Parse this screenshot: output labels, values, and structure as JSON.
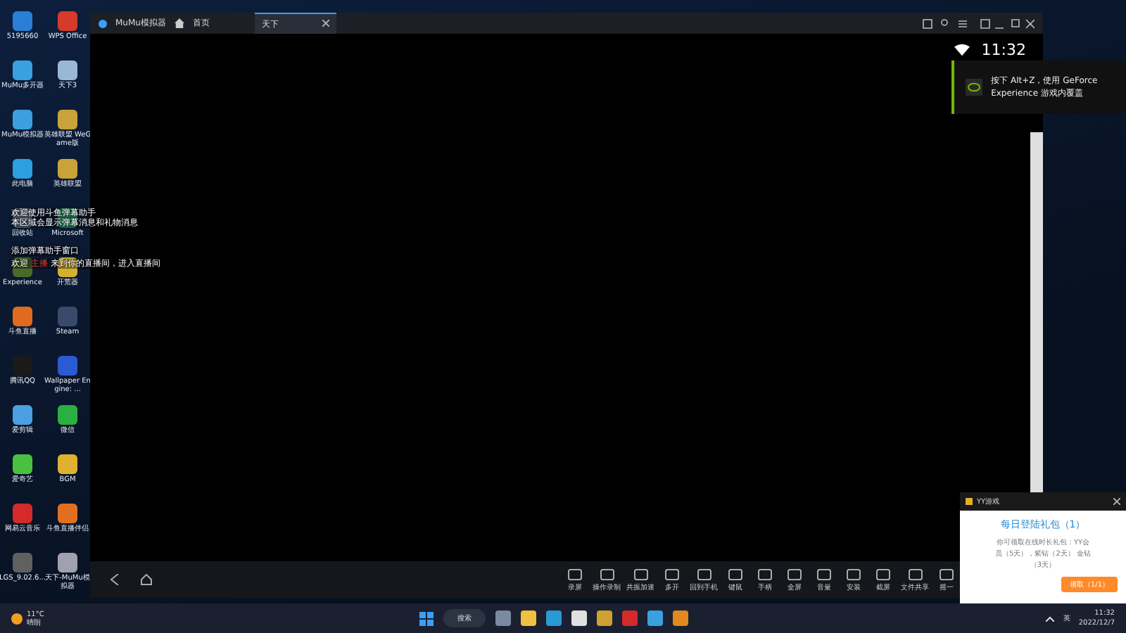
{
  "desktop_icons": [
    {
      "label": "5195660"
    },
    {
      "label": "WPS Office"
    },
    {
      "label": "MuMu多开器"
    },
    {
      "label": "天下3"
    },
    {
      "label": "MuMu模拟器"
    },
    {
      "label": "英雄联盟 WeGame版"
    },
    {
      "label": "此电脑"
    },
    {
      "label": "英雄联盟"
    },
    {
      "label": "回收站"
    },
    {
      "label": "Microsoft"
    },
    {
      "label": "Experience"
    },
    {
      "label": "开荒器"
    },
    {
      "label": "斗鱼直播"
    },
    {
      "label": "Steam"
    },
    {
      "label": "腾讯QQ"
    },
    {
      "label": "Wallpaper Engine: ..."
    },
    {
      "label": "爱剪辑"
    },
    {
      "label": "微信"
    },
    {
      "label": "爱奇艺"
    },
    {
      "label": "BGM"
    },
    {
      "label": "网易云音乐"
    },
    {
      "label": "斗鱼直播伴侣"
    },
    {
      "label": "LGS_9.02.6..."
    },
    {
      "label": "天下-MuMu模拟器"
    }
  ],
  "danmu_overlay": [
    "欢迎使用斗鱼弹幕助手",
    "本区域会显示弹幕消息和礼物消息",
    "添加弹幕助手窗口",
    "欢迎 **主播** 来到你的直播间，进入直播间"
  ],
  "emulator": {
    "app_name": "MuMu模拟器",
    "home_tab": "首页",
    "tabs": [
      {
        "label": "天下",
        "selected": true
      }
    ],
    "status_time": "11:32",
    "toolbar": [
      "录屏",
      "操作录制",
      "共振加速",
      "多开",
      "回到手机",
      "键鼠",
      "手柄",
      "全屏",
      "音量",
      "安装",
      "截屏",
      "文件共享",
      "摇一"
    ]
  },
  "nvidia_notice": "按下 Alt+Z，使用 GeForce Experience 游戏内覆盖",
  "yy_popup": {
    "title": "YY游戏",
    "heading": "每日登陆礼包（1）",
    "body": "你可领取在线时长礼包：YY会员（5天），紫钻（2天） 金钻（3天）",
    "button": "领取（1/1）"
  },
  "taskbar": {
    "temperature": "11°C",
    "weather": "晴朗",
    "search": "搜索",
    "ime": "英",
    "time": "11:32",
    "date": "2022/12/7"
  }
}
